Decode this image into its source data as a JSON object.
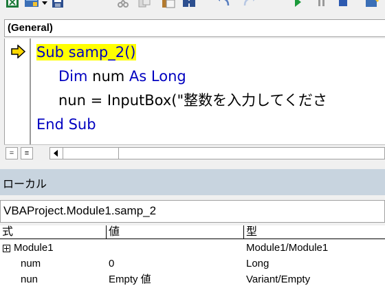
{
  "toolbar": {
    "icons": [
      "view-excel-icon",
      "insert-module-icon",
      "dropdown-arrow-icon",
      "save-icon",
      "cut-icon",
      "copy-icon",
      "paste-icon",
      "find-icon",
      "undo-icon",
      "redo-icon",
      "run-icon",
      "break-icon",
      "reset-icon",
      "design-mode-icon"
    ]
  },
  "object_combo": {
    "value": "(General)"
  },
  "code": {
    "lines": [
      {
        "parts": [
          "Sub samp_2()"
        ]
      },
      {
        "kw": "Dim",
        "mid": " num ",
        "kw2": "As Long"
      },
      {
        "text": "nun = InputBox(\"整数を入力してくださ"
      },
      {
        "kw": "End Sub"
      }
    ],
    "current_line_indicator": "arrow-icon"
  },
  "view_buttons": {
    "procedure_view": "=",
    "module_view": "≡"
  },
  "locals": {
    "title": "ローカル",
    "context": "VBAProject.Module1.samp_2",
    "columns": [
      "式",
      "値",
      "型"
    ],
    "rows": [
      {
        "expr": "Module1",
        "value": "",
        "type": "Module1/Module1",
        "expandable": true
      },
      {
        "expr": "num",
        "value": "0",
        "type": "Long",
        "expandable": false
      },
      {
        "expr": "nun",
        "value": "Empty 値",
        "type": "Variant/Empty",
        "expandable": false
      }
    ]
  },
  "colors": {
    "highlight": "#ffff00",
    "keyword": "#0000c0",
    "titlebar": "#c8d4df",
    "arrow": "#ffd800"
  }
}
